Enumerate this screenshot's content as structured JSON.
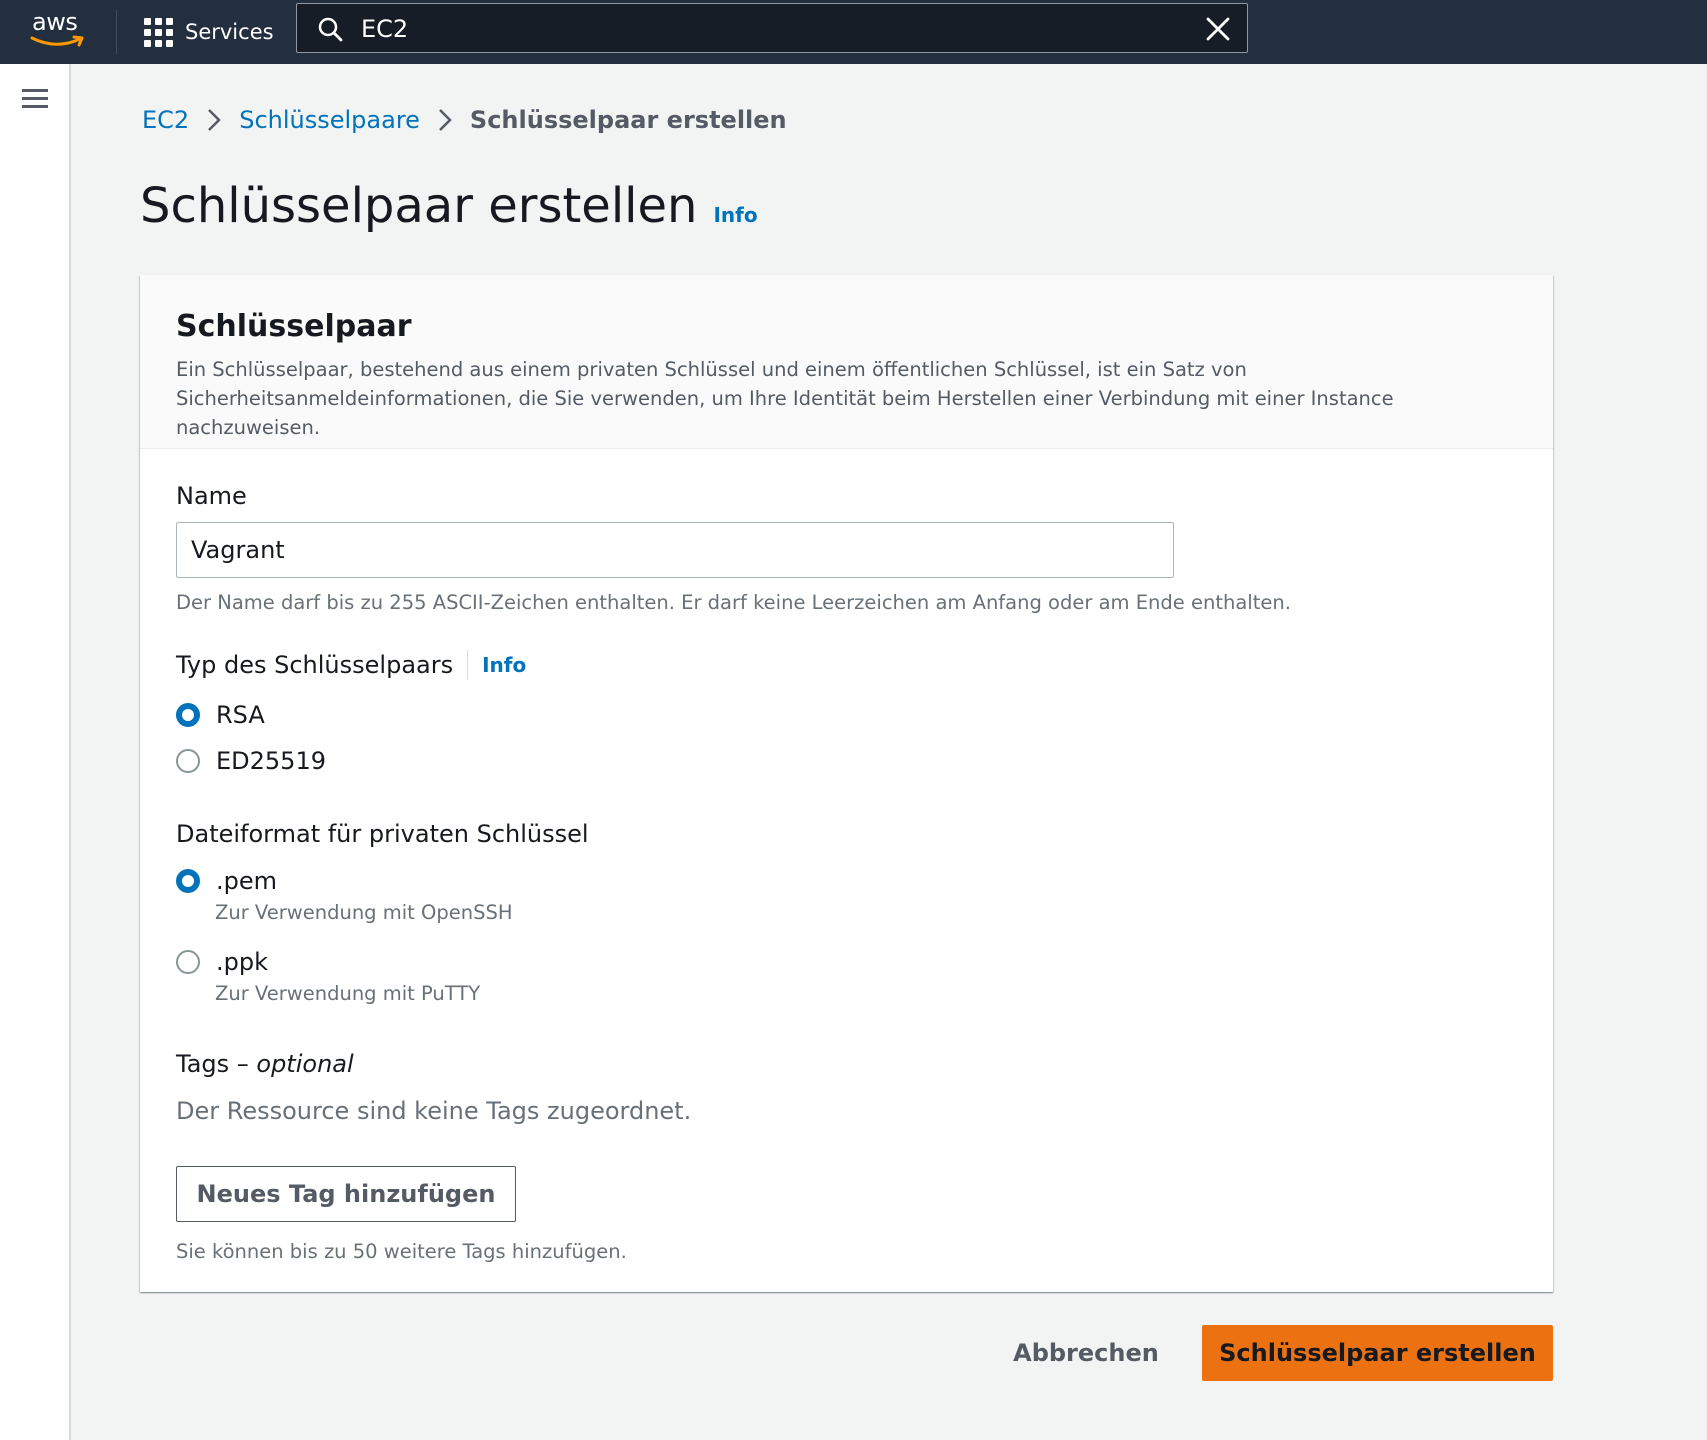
{
  "nav": {
    "logo_text": "aws",
    "services_label": "Services",
    "search_value": "EC2",
    "colors": {
      "bar": "#232f3e",
      "accent": "#ec7211"
    }
  },
  "breadcrumb": {
    "items": [
      "EC2",
      "Schlüsselpaare"
    ],
    "current": "Schlüsselpaar erstellen"
  },
  "page": {
    "title": "Schlüsselpaar erstellen",
    "info_label": "Info"
  },
  "panel": {
    "title": "Schlüsselpaar",
    "description": "Ein Schlüsselpaar, bestehend aus einem privaten Schlüssel und einem öffentlichen Schlüssel, ist ein Satz von Sicherheitsanmeldeinformationen, die Sie verwenden, um Ihre Identität beim Herstellen einer Verbindung mit einer Instance nachzuweisen."
  },
  "form": {
    "name": {
      "label": "Name",
      "value": "Vagrant",
      "hint": "Der Name darf bis zu 255 ASCII-Zeichen enthalten. Er darf keine Leerzeichen am Anfang oder am Ende enthalten."
    },
    "key_type": {
      "label": "Typ des Schlüsselpaars",
      "info_label": "Info",
      "options": [
        {
          "label": "RSA",
          "checked": true
        },
        {
          "label": "ED25519",
          "checked": false
        }
      ]
    },
    "file_format": {
      "label": "Dateiformat für privaten Schlüssel",
      "options": [
        {
          "label": ".pem",
          "description": "Zur Verwendung mit OpenSSH",
          "checked": true
        },
        {
          "label": ".ppk",
          "description": "Zur Verwendung mit PuTTY",
          "checked": false
        }
      ]
    },
    "tags": {
      "label": "Tags – ",
      "label_optional": "optional",
      "empty_text": "Der Ressource sind keine Tags zugeordnet.",
      "add_button": "Neues Tag hinzufügen",
      "hint": "Sie können bis zu 50 weitere Tags hinzufügen."
    }
  },
  "actions": {
    "cancel": "Abbrechen",
    "submit": "Schlüsselpaar erstellen"
  }
}
